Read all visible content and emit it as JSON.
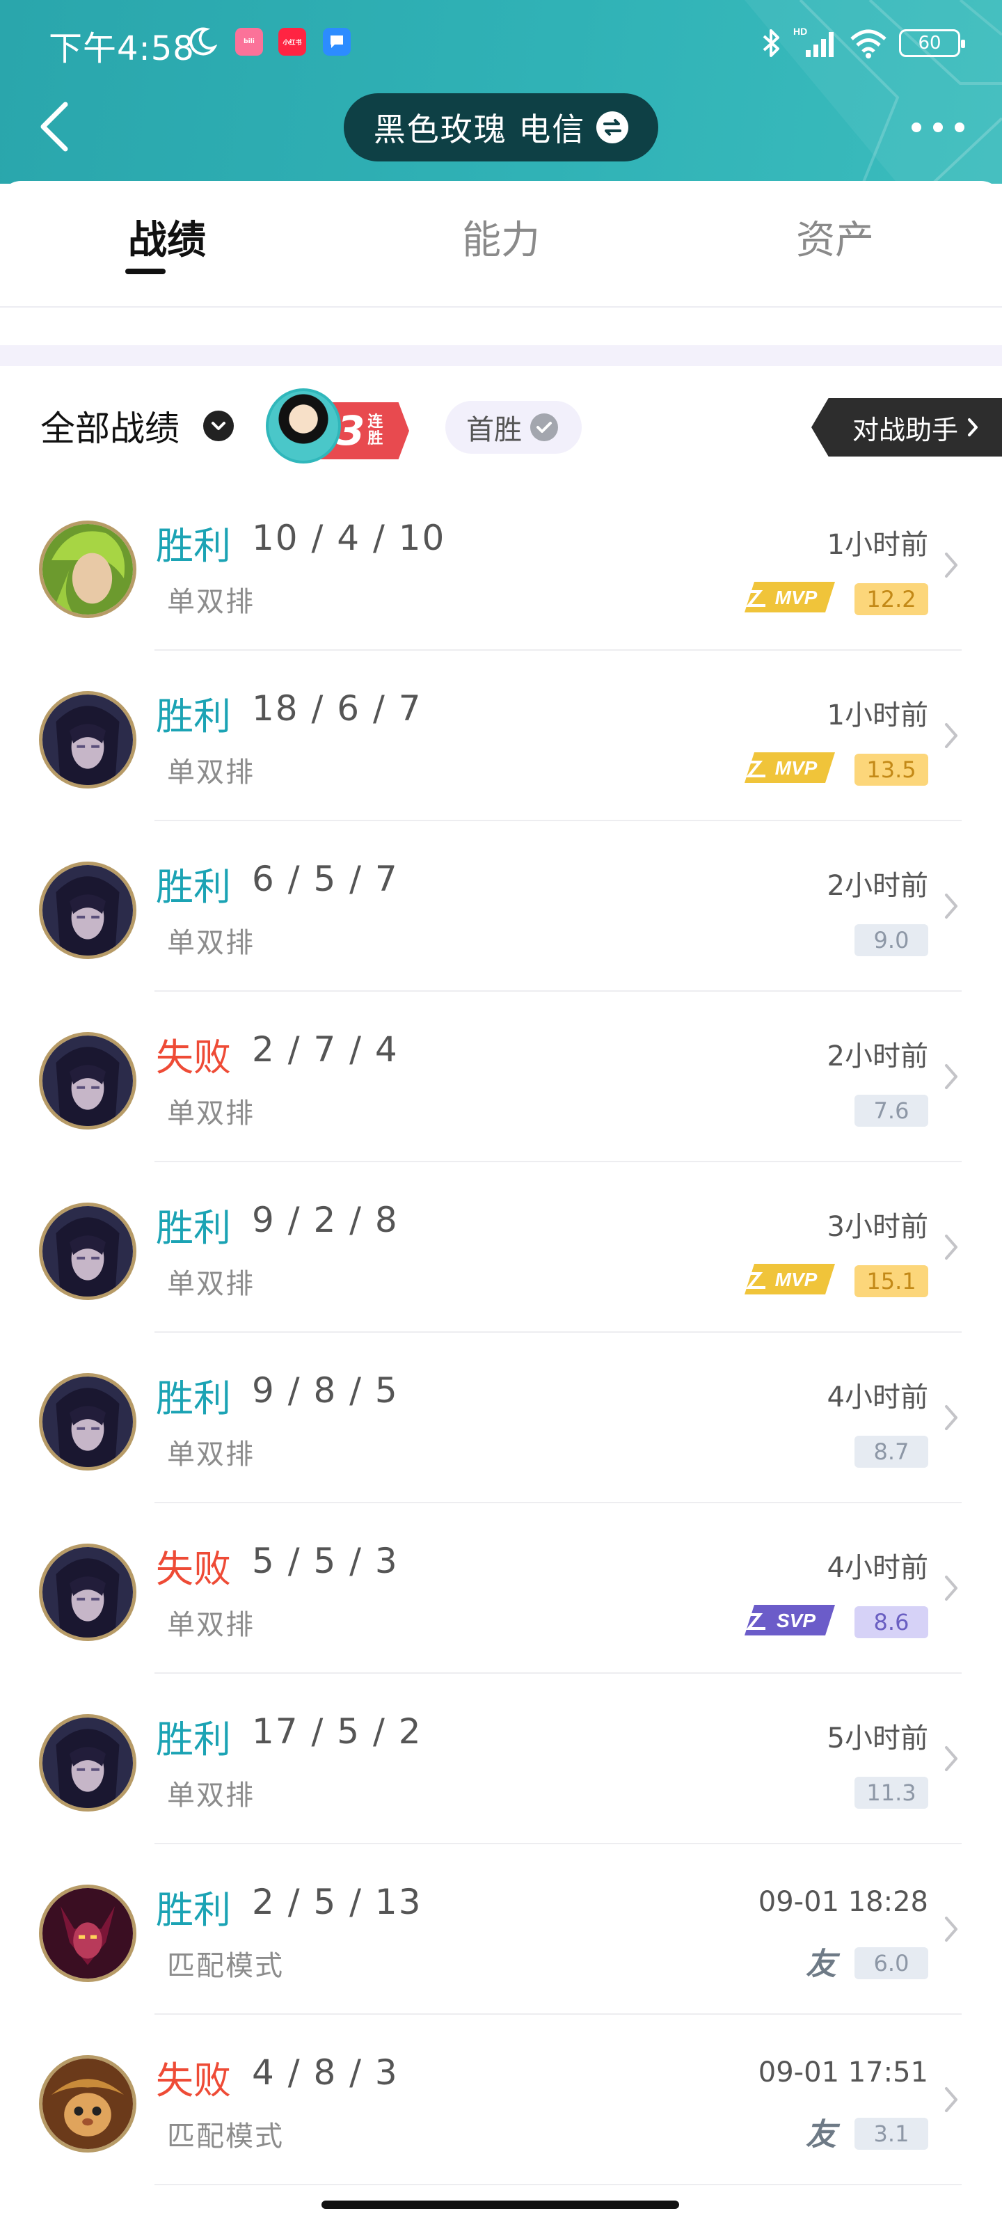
{
  "status_bar": {
    "time": "下午4:58",
    "apps": [
      "bilibili-icon",
      "xiaohongshu-icon",
      "message-icon"
    ],
    "app_labels": {
      "bilibili": "bili",
      "xiaohongshu": "小红书"
    },
    "hd_label": "HD",
    "battery": "60"
  },
  "header": {
    "account_name": "黑色玫瑰 电信",
    "colors": {
      "bg": "#2aa6ac",
      "pill": "#0e4045"
    }
  },
  "tabs": [
    {
      "label": "战绩",
      "active": true
    },
    {
      "label": "能力",
      "active": false
    },
    {
      "label": "资产",
      "active": false
    }
  ],
  "filter": {
    "label": "全部战绩",
    "streak_number": "3",
    "streak_text": "连胜",
    "first_win": "首胜",
    "assist_button": "对战助手"
  },
  "matches": [
    {
      "result": "胜利",
      "outcome": "win",
      "kda": "10 / 4 / 10",
      "mode": "单双排",
      "time": "1小时前",
      "score": "12.2",
      "score_style": "gold",
      "badge": "MVP",
      "hero": "green-hair-icon"
    },
    {
      "result": "胜利",
      "outcome": "win",
      "kda": "18 / 6 / 7",
      "mode": "单双排",
      "time": "1小时前",
      "score": "13.5",
      "score_style": "gold",
      "badge": "MVP",
      "hero": "dark-hero-icon"
    },
    {
      "result": "胜利",
      "outcome": "win",
      "kda": "6 / 5 / 7",
      "mode": "单双排",
      "time": "2小时前",
      "score": "9.0",
      "score_style": "plain",
      "badge": "",
      "hero": "dark-hero-icon"
    },
    {
      "result": "失败",
      "outcome": "loss",
      "kda": "2 / 7 / 4",
      "mode": "单双排",
      "time": "2小时前",
      "score": "7.6",
      "score_style": "plain",
      "badge": "",
      "hero": "dark-hero-icon"
    },
    {
      "result": "胜利",
      "outcome": "win",
      "kda": "9 / 2 / 8",
      "mode": "单双排",
      "time": "3小时前",
      "score": "15.1",
      "score_style": "gold",
      "badge": "MVP",
      "hero": "dark-hero-icon"
    },
    {
      "result": "胜利",
      "outcome": "win",
      "kda": "9 / 8 / 5",
      "mode": "单双排",
      "time": "4小时前",
      "score": "8.7",
      "score_style": "plain",
      "badge": "",
      "hero": "dark-hero-icon"
    },
    {
      "result": "失败",
      "outcome": "loss",
      "kda": "5 / 5 / 3",
      "mode": "单双排",
      "time": "4小时前",
      "score": "8.6",
      "score_style": "purple",
      "badge": "SVP",
      "hero": "dark-hero-icon"
    },
    {
      "result": "胜利",
      "outcome": "win",
      "kda": "17 / 5 / 2",
      "mode": "单双排",
      "time": "5小时前",
      "score": "11.3",
      "score_style": "plain",
      "badge": "",
      "hero": "dark-hero-icon"
    },
    {
      "result": "胜利",
      "outcome": "win",
      "kda": "2 / 5 / 13",
      "mode": "匹配模式",
      "time": "09-01 18:28",
      "score": "6.0",
      "score_style": "plain",
      "badge": "友",
      "hero": "red-demon-icon"
    },
    {
      "result": "失败",
      "outcome": "loss",
      "kda": "4 / 8 / 3",
      "mode": "匹配模式",
      "time": "09-01 17:51",
      "score": "3.1",
      "score_style": "plain",
      "badge": "友",
      "hero": "teemo-icon"
    }
  ]
}
